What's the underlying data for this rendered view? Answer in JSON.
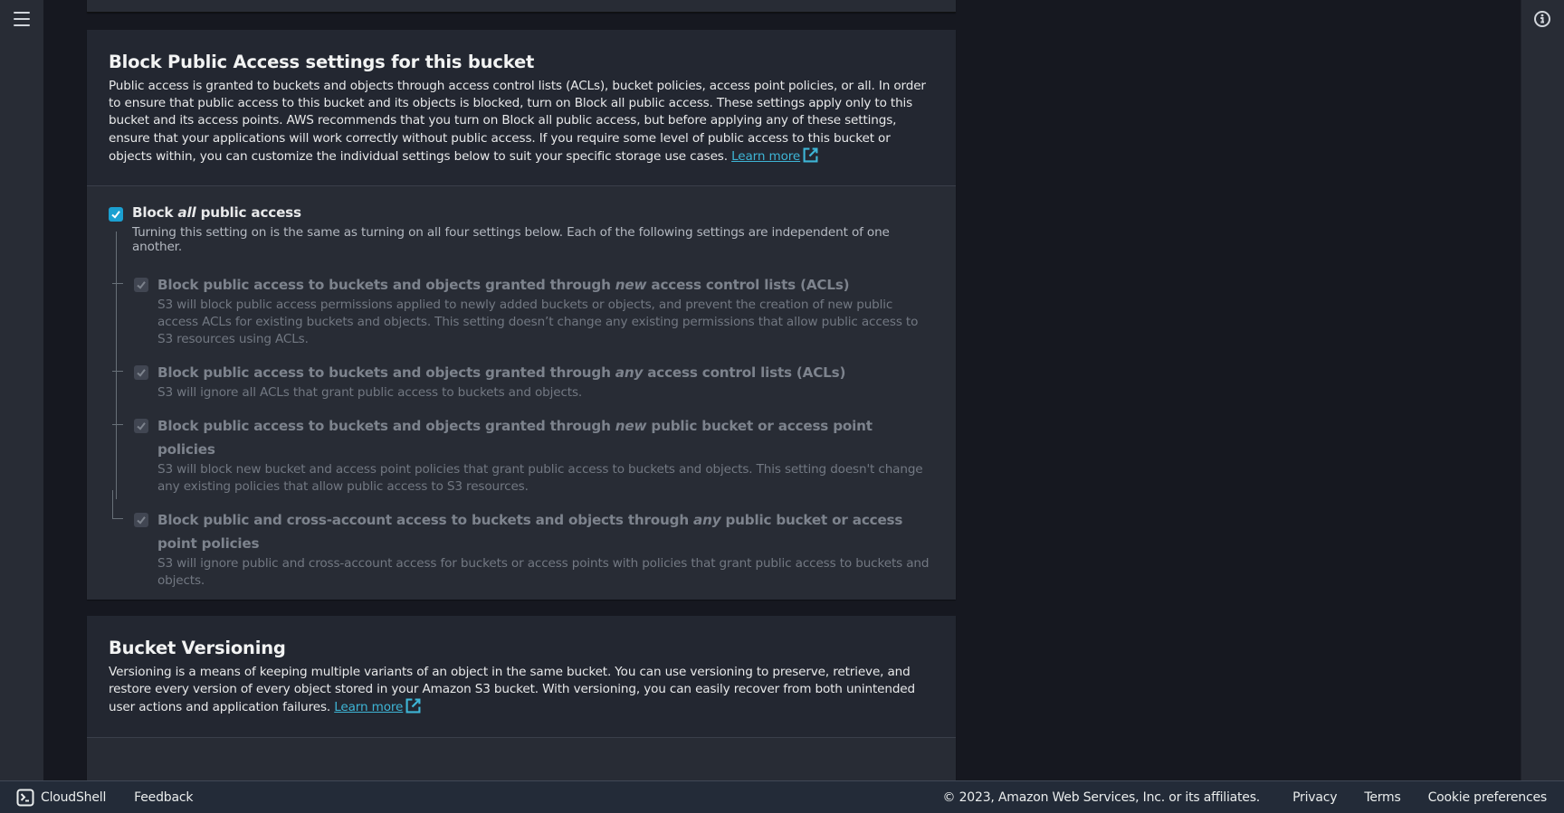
{
  "block_public_access": {
    "title": "Block Public Access settings for this bucket",
    "description": "Public access is granted to buckets and objects through access control lists (ACLs), bucket policies, access point policies, or all. In order to ensure that public access to this bucket and its objects is blocked, turn on Block all public access. These settings apply only to this bucket and its access points. AWS recommends that you turn on Block all public access, but before applying any of these settings, ensure that your applications will work correctly without public access. If you require some level of public access to this bucket or objects within, you can customize the individual settings below to suit your specific storage use cases.",
    "learn_more": "Learn more",
    "master": {
      "label_pre": "Block ",
      "label_em": "all",
      "label_post": " public access",
      "checked": true,
      "description": "Turning this setting on is the same as turning on all four settings below. Each of the following settings are independent of one another."
    },
    "options": [
      {
        "label_pre": "Block public access to buckets and objects granted through ",
        "label_em": "new",
        "label_post": " access control lists (ACLs)",
        "checked": true,
        "disabled": true,
        "description": "S3 will block public access permissions applied to newly added buckets or objects, and prevent the creation of new public access ACLs for existing buckets and objects. This setting doesn’t change any existing permissions that allow public access to S3 resources using ACLs."
      },
      {
        "label_pre": "Block public access to buckets and objects granted through ",
        "label_em": "any",
        "label_post": " access control lists (ACLs)",
        "checked": true,
        "disabled": true,
        "description": "S3 will ignore all ACLs that grant public access to buckets and objects."
      },
      {
        "label_pre": "Block public access to buckets and objects granted through ",
        "label_em": "new",
        "label_post": " public bucket or access point policies",
        "checked": true,
        "disabled": true,
        "description": "S3 will block new bucket and access point policies that grant public access to buckets and objects. This setting doesn't change any existing policies that allow public access to S3 resources."
      },
      {
        "label_pre": "Block public and cross-account access to buckets and objects through ",
        "label_em": "any",
        "label_post": " public bucket or access point policies",
        "checked": true,
        "disabled": true,
        "description": "S3 will ignore public and cross-account access for buckets or access points with policies that grant public access to buckets and objects."
      }
    ]
  },
  "bucket_versioning": {
    "title": "Bucket Versioning",
    "description": "Versioning is a means of keeping multiple variants of an object in the same bucket. You can use versioning to preserve, retrieve, and restore every version of every object stored in your Amazon S3 bucket. With versioning, you can easily recover from both unintended user actions and application failures.",
    "learn_more": "Learn more"
  },
  "footer": {
    "cloudshell": "CloudShell",
    "feedback": "Feedback",
    "copyright": "© 2023, Amazon Web Services, Inc. or its affiliates.",
    "privacy": "Privacy",
    "terms": "Terms",
    "cookie_preferences": "Cookie preferences"
  },
  "colors": {
    "accent": "#1ba0d1",
    "link": "#3eb5d6"
  }
}
